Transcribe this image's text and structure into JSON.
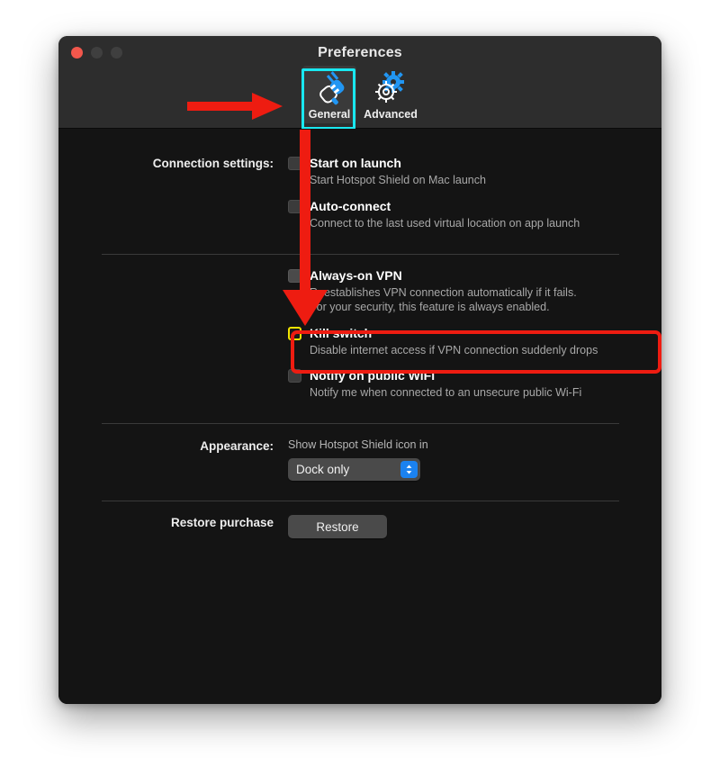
{
  "window": {
    "title": "Preferences",
    "traffic_lights": [
      "close",
      "minimize",
      "zoom"
    ]
  },
  "toolbar": {
    "items": [
      {
        "label": "General",
        "icon": "plug-icon",
        "selected": true
      },
      {
        "label": "Advanced",
        "icon": "gears-icon",
        "selected": false
      }
    ]
  },
  "sections": {
    "connection": {
      "label": "Connection settings:",
      "options": [
        {
          "title": "Start on launch",
          "desc": "Start Hotspot Shield on Mac launch",
          "checked": false
        },
        {
          "title": "Auto-connect",
          "desc": "Connect to the last used virtual location on app launch",
          "checked": false
        }
      ]
    },
    "security": {
      "options": [
        {
          "title": "Always-on VPN",
          "desc": "Reestablishes VPN connection automatically if it fails.\nFor your security, this feature is always enabled.",
          "checked": true
        },
        {
          "title": "Kill switch",
          "desc": "Disable internet access if VPN connection suddenly drops",
          "checked": false
        },
        {
          "title": "Notify on public WiFi",
          "desc": "Notify me when connected to an unsecure public Wi-Fi",
          "checked": false
        }
      ]
    },
    "appearance": {
      "label": "Appearance:",
      "caption": "Show Hotspot Shield icon in",
      "dropdown_value": "Dock only"
    },
    "restore": {
      "label": "Restore purchase",
      "button_label": "Restore"
    }
  },
  "annotations": {
    "general_highlight_color": "#19e8f0",
    "arrow_color": "#ee1c11",
    "kill_switch_box_color": "#ee1c11",
    "kill_switch_checkbox_color": "#f2e400"
  },
  "colors": {
    "titlebar": "#2d2d2d",
    "body": "#141414",
    "accent_blue": "#1b82f0",
    "text_primary": "#ffffff",
    "text_secondary": "#a8a8a8"
  }
}
